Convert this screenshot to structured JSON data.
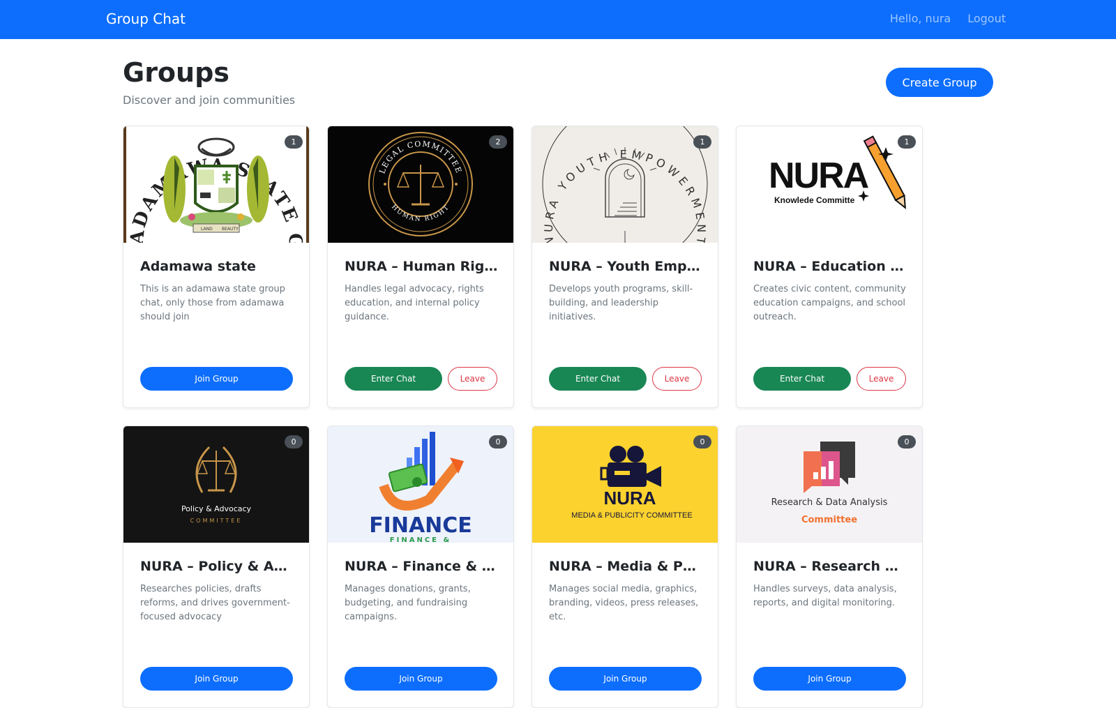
{
  "navbar": {
    "brand": "Group Chat",
    "greeting": "Hello, nura",
    "logout": "Logout",
    "color": "#0d6efd"
  },
  "header": {
    "title": "Groups",
    "subtitle": "Discover and join communities",
    "create_label": "Create Group"
  },
  "buttons": {
    "join": "Join Group",
    "enter": "Enter Chat",
    "leave": "Leave"
  },
  "groups": [
    {
      "name": "Adamawa state",
      "description": "This is an adamawa state group chat, only those from adamawa should join",
      "members": "1",
      "joined": false,
      "image": {
        "ring_text": "ADAMAWA STATE GOVERNMENT",
        "motto_left": "LAND",
        "motto_right": "BEAUTY"
      }
    },
    {
      "name": "NURA – Human Rights & Legal Committee",
      "description": "Handles legal advocacy, rights education, and internal policy guidance.",
      "members": "2",
      "joined": true,
      "image": {
        "top_text": "LEGAL COMMITTEE",
        "bottom_text": "HUMAN RIGHT"
      }
    },
    {
      "name": "NURA – Youth Empowerment Committee",
      "description": "Develops youth programs, skill-building, and leadership initiatives.",
      "members": "1",
      "joined": true,
      "image": {
        "ring_text": "NURA YOUTH EMPOWERMENT COMMITTEE"
      }
    },
    {
      "name": "NURA – Education & Awareness Committee",
      "description": "Creates civic content, community education campaigns, and school outreach.",
      "members": "1",
      "joined": true,
      "image": {
        "logo": "NURA",
        "sub": "Knowlede Committe"
      }
    },
    {
      "name": "NURA – Policy & Advocacy Committee",
      "description": "Researches policies, drafts reforms, and drives government-focused advocacy",
      "members": "0",
      "joined": false,
      "image": {
        "title": "Policy & Advocacy",
        "sub": "COMMITTEE"
      }
    },
    {
      "name": "NURA – Finance & Fundraising Committee",
      "description": "Manages donations, grants, budgeting, and fundraising campaigns.",
      "members": "0",
      "joined": false,
      "image": {
        "title": "FINANCE",
        "sub": "FINANCE &"
      }
    },
    {
      "name": "NURA – Media & Publicity Committee",
      "description": "Manages social media, graphics, branding, videos, press releases, etc.",
      "members": "0",
      "joined": false,
      "image": {
        "logo": "NURA",
        "sub": "MEDIA & PUBLICITY COMMITTEE"
      }
    },
    {
      "name": "NURA – Research & Data Analysis Committee",
      "description": "Handles surveys, data analysis, reports, and digital monitoring.",
      "members": "0",
      "joined": false,
      "image": {
        "title": "Research & Data Analysis",
        "sub": "Committee"
      }
    }
  ]
}
